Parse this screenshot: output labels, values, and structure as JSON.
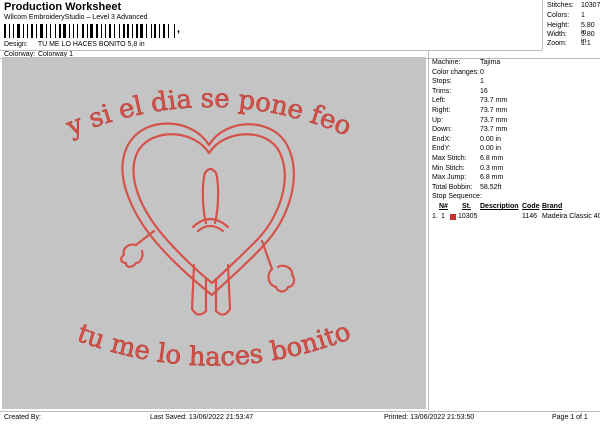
{
  "header": {
    "title": "Production Worksheet",
    "software": "Wilcom EmbroideryStudio – Level 3 Advanced",
    "design_label": "Design:",
    "design_value": "TU ME LO HACES BONITO 5,8 in",
    "colorway_label": "Colorway:",
    "colorway_value": "Colorway 1"
  },
  "stats": {
    "stitches_label": "Stitches:",
    "stitches": "10307",
    "colors_label": "Colors:",
    "colors": "1",
    "height_label": "Height:",
    "height": "5.80 in",
    "width_label": "Width:",
    "width": "5.80 in",
    "zoom_label": "Zoom:",
    "zoom": "1:1"
  },
  "design_text": {
    "top": "y si el dia se pone feo",
    "bottom": "tu me lo haces bonito"
  },
  "details": [
    {
      "label": "Machine:",
      "value": "Tajima"
    },
    {
      "label": "Color changes:",
      "value": "0"
    },
    {
      "label": "Stops:",
      "value": "1"
    },
    {
      "label": "Trims:",
      "value": "16"
    },
    {
      "label": "Left:",
      "value": "73.7 mm"
    },
    {
      "label": "Right:",
      "value": "73.7 mm"
    },
    {
      "label": "Up:",
      "value": "73.7 mm"
    },
    {
      "label": "Down:",
      "value": "73.7 mm"
    },
    {
      "label": "EndX:",
      "value": "0.00 in"
    },
    {
      "label": "EndY:",
      "value": "0.00 in"
    },
    {
      "label": "Max Stitch:",
      "value": "6.8 mm"
    },
    {
      "label": "Min Stitch:",
      "value": "0.3 mm"
    },
    {
      "label": "Max Jump:",
      "value": "6.8 mm"
    },
    {
      "label": "Total Bobbin:",
      "value": "58.52ft"
    }
  ],
  "stop_sequence": {
    "label": "Stop Sequence:",
    "headers": {
      "n": "N#",
      "st": "St.",
      "desc": "Description",
      "code": "Code",
      "brand": "Brand"
    },
    "rows": [
      {
        "index": "1.",
        "n": "1",
        "color": "#c8302e",
        "st": "10305",
        "desc": "",
        "code": "1146",
        "brand": "Madeira Classic 40"
      }
    ]
  },
  "footer": {
    "created": "Created By:",
    "saved": "Last Saved: 13/06/2022 21:53:47",
    "printed": "Printed: 13/06/2022 21:53:50",
    "page": "Page 1 of 1"
  },
  "colors": {
    "thread": "#d4524a",
    "canvas": "#c4c4c4"
  }
}
